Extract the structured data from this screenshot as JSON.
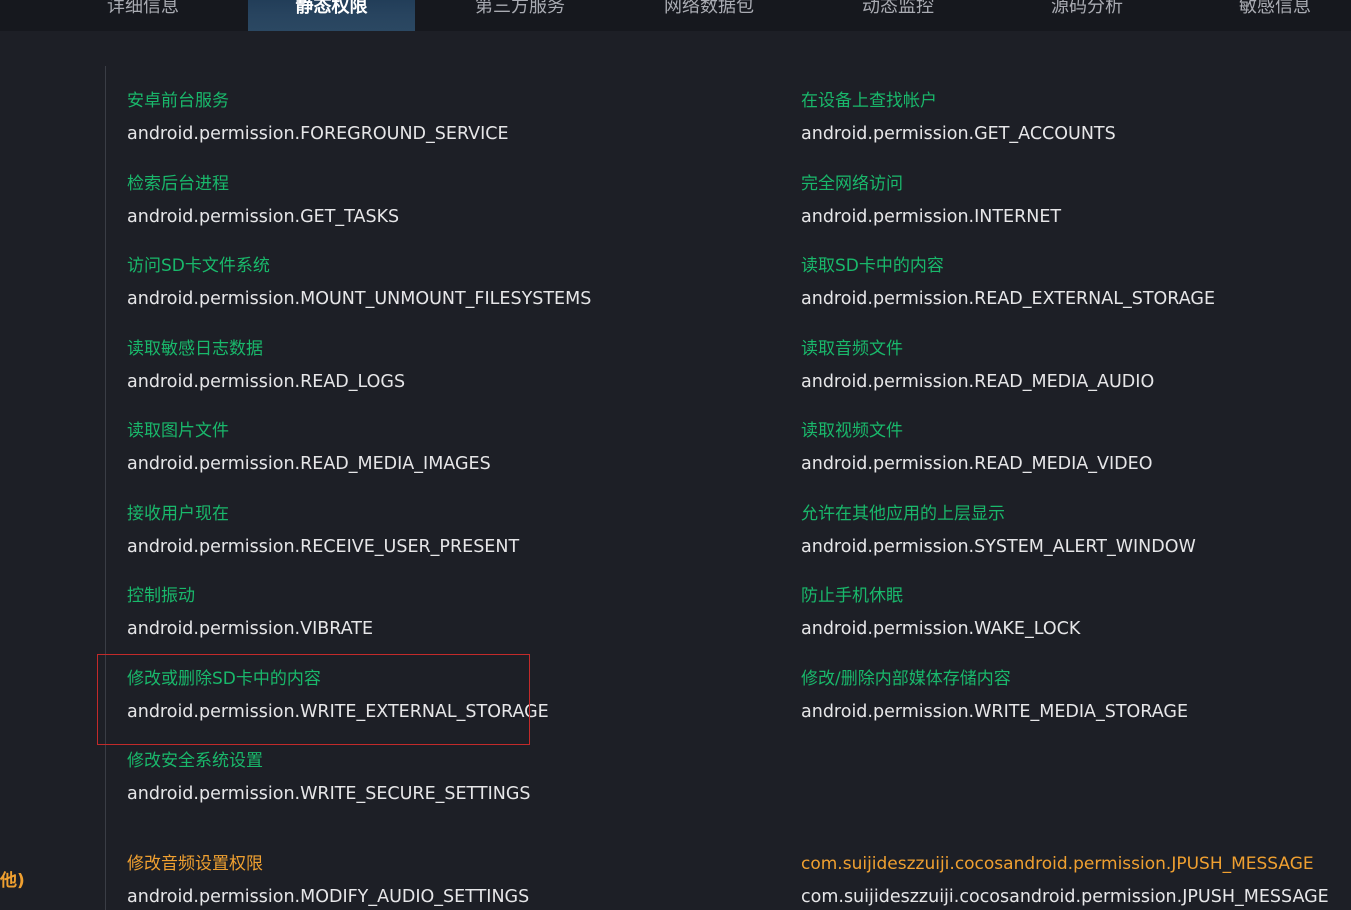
{
  "tabs": [
    {
      "label": "详细信息",
      "active": false
    },
    {
      "label": "静态权限",
      "active": true
    },
    {
      "label": "第三方服务",
      "active": false
    },
    {
      "label": "网络数据包",
      "active": false
    },
    {
      "label": "动态监控",
      "active": false
    },
    {
      "label": "源码分析",
      "active": false
    },
    {
      "label": "敏感信息",
      "active": false
    }
  ],
  "permissions": {
    "left": [
      {
        "name": "安卓前台服务",
        "permission": "android.permission.FOREGROUND_SERVICE"
      },
      {
        "name": "检索后台进程",
        "permission": "android.permission.GET_TASKS"
      },
      {
        "name": "访问SD卡文件系统",
        "permission": "android.permission.MOUNT_UNMOUNT_FILESYSTEMS"
      },
      {
        "name": "读取敏感日志数据",
        "permission": "android.permission.READ_LOGS"
      },
      {
        "name": "读取图片文件",
        "permission": "android.permission.READ_MEDIA_IMAGES"
      },
      {
        "name": "接收用户现在",
        "permission": "android.permission.RECEIVE_USER_PRESENT"
      },
      {
        "name": "控制振动",
        "permission": "android.permission.VIBRATE"
      },
      {
        "name": "修改或删除SD卡中的内容",
        "permission": "android.permission.WRITE_EXTERNAL_STORAGE",
        "highlighted": true
      },
      {
        "name": "修改安全系统设置",
        "permission": "android.permission.WRITE_SECURE_SETTINGS"
      }
    ],
    "right": [
      {
        "name": "在设备上查找帐户",
        "permission": "android.permission.GET_ACCOUNTS"
      },
      {
        "name": "完全网络访问",
        "permission": "android.permission.INTERNET"
      },
      {
        "name": "读取SD卡中的内容",
        "permission": "android.permission.READ_EXTERNAL_STORAGE"
      },
      {
        "name": "读取音频文件",
        "permission": "android.permission.READ_MEDIA_AUDIO"
      },
      {
        "name": "读取视频文件",
        "permission": "android.permission.READ_MEDIA_VIDEO"
      },
      {
        "name": "允许在其他应用的上层显示",
        "permission": "android.permission.SYSTEM_ALERT_WINDOW"
      },
      {
        "name": "防止手机休眠",
        "permission": "android.permission.WAKE_LOCK"
      },
      {
        "name": "修改/删除内部媒体存储内容",
        "permission": "android.permission.WRITE_MEDIA_STORAGE"
      }
    ]
  },
  "other_section": {
    "label": "他)",
    "left": {
      "name": "修改音频设置权限",
      "permission": "android.permission.MODIFY_AUDIO_SETTINGS"
    },
    "right": {
      "name": "com.suijideszzuiji.cocosandroid.permission.JPUSH_MESSAGE",
      "permission": "com.suijideszzuiji.cocosandroid.permission.JPUSH_MESSAGE"
    }
  },
  "colors": {
    "background": "#1d1f26",
    "tabbar": "#16181e",
    "permission_name": "#19b86b",
    "other_name": "#f0a030",
    "permission_text": "#e6e6e8",
    "highlight_border": "#c22a2a"
  }
}
